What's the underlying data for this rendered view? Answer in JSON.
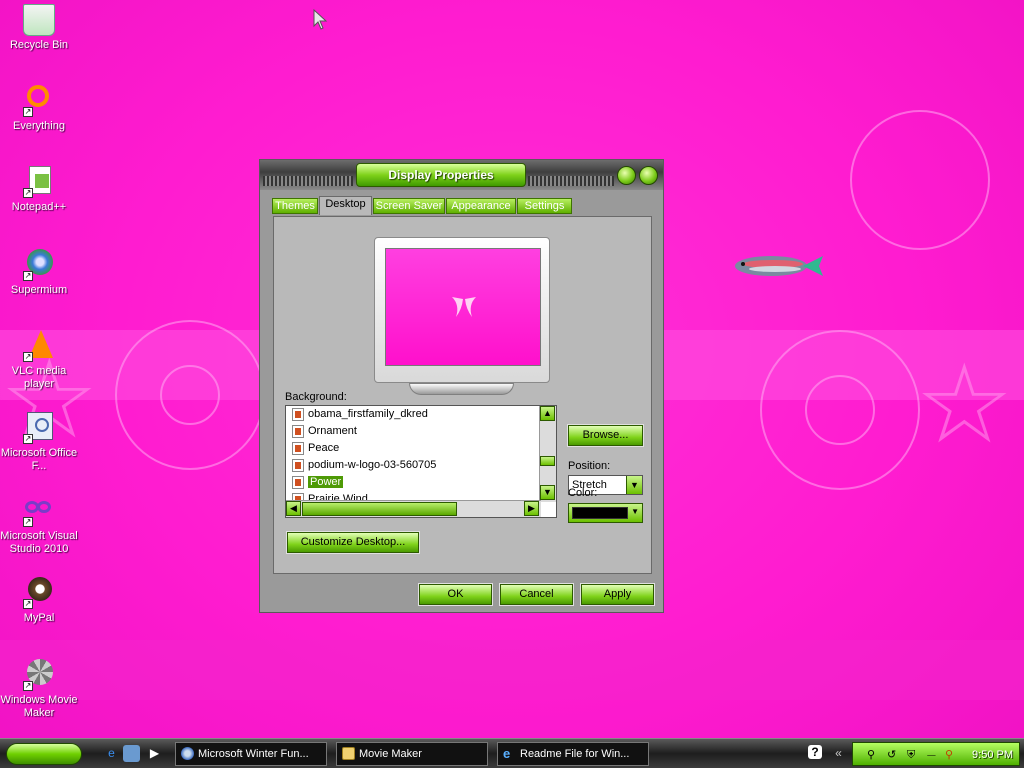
{
  "desktop_icons": [
    {
      "label": "Recycle Bin",
      "icon": "recycle-bin-icon"
    },
    {
      "label": "Everything",
      "icon": "everything-icon"
    },
    {
      "label": "Notepad++",
      "icon": "notepad-plus-plus-icon"
    },
    {
      "label": "Supermium",
      "icon": "supermium-icon"
    },
    {
      "label": "VLC media player",
      "icon": "vlc-icon"
    },
    {
      "label": "Microsoft Office F...",
      "icon": "office-icon"
    },
    {
      "label": "Microsoft Visual Studio 2010",
      "icon": "visual-studio-icon"
    },
    {
      "label": "MyPal",
      "icon": "mypal-icon"
    },
    {
      "label": "Windows Movie Maker",
      "icon": "movie-maker-icon"
    }
  ],
  "dialog": {
    "title": "Display Properties",
    "tabs": [
      "Themes",
      "Desktop",
      "Screen Saver",
      "Appearance",
      "Settings"
    ],
    "active_tab": "Desktop",
    "background_label": "Background:",
    "background_items": [
      {
        "name": "obama_firstfamily_dkred",
        "selected": false
      },
      {
        "name": "Ornament",
        "selected": false
      },
      {
        "name": "Peace",
        "selected": false
      },
      {
        "name": "podium-w-logo-03-560705",
        "selected": false
      },
      {
        "name": "Power",
        "selected": true
      },
      {
        "name": "Prairie Wind",
        "selected": false
      }
    ],
    "browse_label": "Browse...",
    "position_label": "Position:",
    "position_value": "Stretch",
    "color_label": "Color:",
    "color_value": "#000000",
    "customize_label": "Customize Desktop...",
    "ok_label": "OK",
    "cancel_label": "Cancel",
    "apply_label": "Apply"
  },
  "taskbar": {
    "tasks": [
      {
        "label": "Microsoft Winter Fun...",
        "icon": "browser-icon"
      },
      {
        "label": "Movie Maker",
        "icon": "folder-icon"
      },
      {
        "label": "Readme File for Win...",
        "icon": "ie-icon"
      }
    ],
    "quick_launch": [
      "ie-icon",
      "media-icon",
      "play-icon"
    ],
    "clock": "9:50 PM",
    "accent": "#6fd000"
  }
}
